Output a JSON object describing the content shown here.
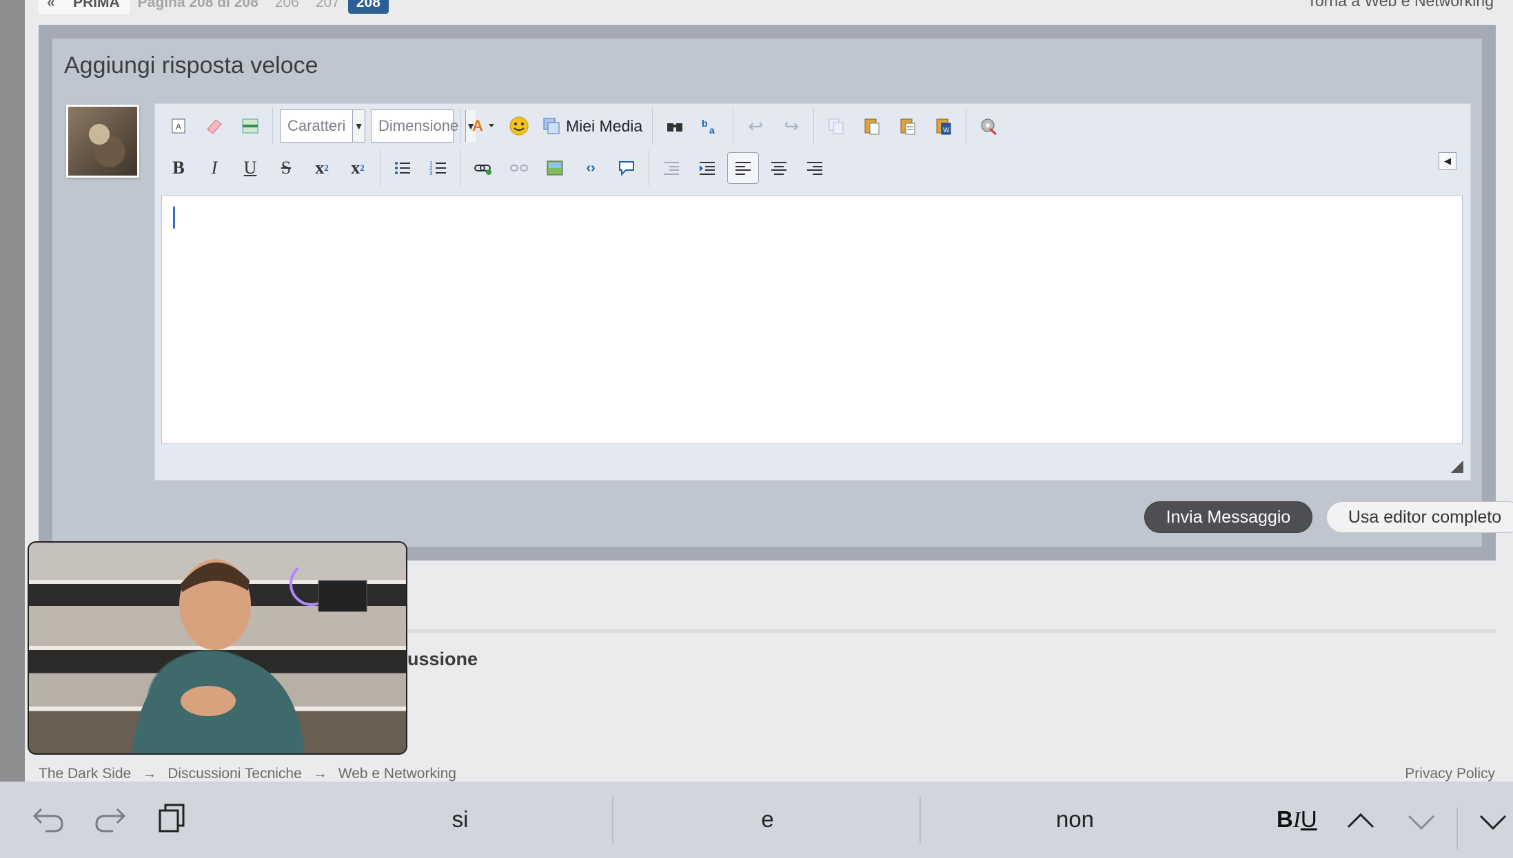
{
  "pagination": {
    "prev": "«",
    "first": "PRIMA",
    "info": "Pagina 208 di 208",
    "pages": [
      "206",
      "207"
    ],
    "current": "208"
  },
  "back_link": "Torna a Web e Networking",
  "quick_reply": {
    "title": "Aggiungi risposta veloce",
    "font_select": "Caratteri",
    "size_select": "Dimensione",
    "media_label": "Miei Media",
    "send_button": "Invia Messaggio",
    "full_editor_button": "Usa editor completo"
  },
  "toolbar": {
    "row1_icons": [
      "remove-format-icon",
      "eraser-icon",
      "wysiwyg-toggle-icon",
      "text-color-icon",
      "smiley-icon",
      "my-media-icon",
      "find-icon",
      "replace-icon",
      "undo-icon",
      "redo-icon",
      "copy-icon",
      "paste-icon",
      "paste-text-icon",
      "paste-word-icon",
      "settings-icon"
    ],
    "row2_icons": [
      "bold-icon",
      "italic-icon",
      "underline-icon",
      "strikethrough-icon",
      "subscript-icon",
      "superscript-icon",
      "bullet-list-icon",
      "numbered-list-icon",
      "link-icon",
      "unlink-icon",
      "image-icon",
      "code-icon",
      "quote-icon",
      "outdent-icon",
      "indent-icon",
      "align-left-icon",
      "align-center-icon",
      "align-right-icon"
    ]
  },
  "section_heading": "ussione",
  "breadcrumb": [
    "The Dark Side",
    "Discussioni Tecniche",
    "Web e Networking"
  ],
  "breadcrumb_sep": "→",
  "privacy": "Privacy Policy",
  "keyboard": {
    "suggestions": [
      "si",
      "e",
      "non"
    ],
    "format": {
      "b": "B",
      "i": "I",
      "u": "U"
    }
  },
  "colors": {
    "accent": "#2c5f93",
    "send_button": "#4d4f53",
    "panel": "#c0c6d0"
  }
}
